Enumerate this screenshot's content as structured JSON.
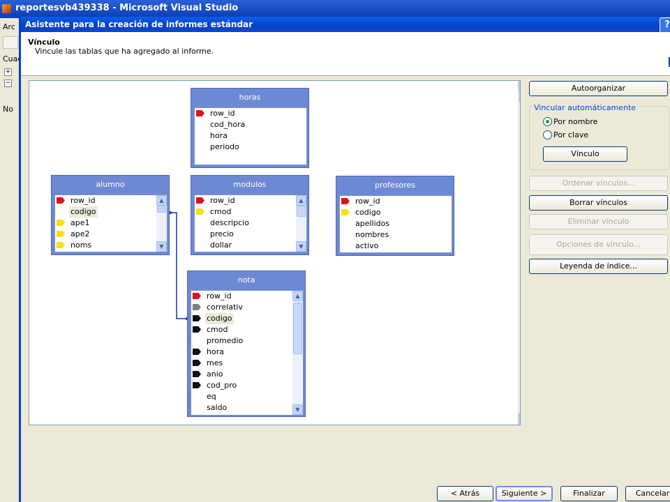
{
  "vs": {
    "title": "reportesvb439338 - Microsoft Visual Studio",
    "left_fragments": [
      "Arc",
      "Cuac",
      "No"
    ]
  },
  "dialog": {
    "title": "Asistente para la creación de informes estándar",
    "help": "?",
    "header_title": "Vínculo",
    "header_subtitle": "Vincule las tablas que ha agregado al informe."
  },
  "tables": {
    "horas": {
      "name": "horas",
      "fields": [
        {
          "name": "row_id",
          "key": "red"
        },
        {
          "name": "cod_hora",
          "key": ""
        },
        {
          "name": "hora",
          "key": ""
        },
        {
          "name": "periodo",
          "key": ""
        }
      ]
    },
    "alumno": {
      "name": "alumno",
      "fields": [
        {
          "name": "row_id",
          "key": "red"
        },
        {
          "name": "codigo",
          "key": ""
        },
        {
          "name": "ape1",
          "key": "yellow"
        },
        {
          "name": "ape2",
          "key": "yellow"
        },
        {
          "name": "noms",
          "key": "yellow"
        }
      ]
    },
    "modulos": {
      "name": "modulos",
      "fields": [
        {
          "name": "row_id",
          "key": "red"
        },
        {
          "name": "cmod",
          "key": "yellow"
        },
        {
          "name": "descripcio",
          "key": ""
        },
        {
          "name": "precio",
          "key": ""
        },
        {
          "name": "dollar",
          "key": ""
        }
      ]
    },
    "profesores": {
      "name": "profesores",
      "fields": [
        {
          "name": "row_id",
          "key": "red"
        },
        {
          "name": "codigo",
          "key": "yellow"
        },
        {
          "name": "apellidos",
          "key": ""
        },
        {
          "name": "nombres",
          "key": ""
        },
        {
          "name": "activo",
          "key": ""
        }
      ]
    },
    "nota": {
      "name": "nota",
      "fields": [
        {
          "name": "row_id",
          "key": "red"
        },
        {
          "name": "correlativ",
          "key": "gray"
        },
        {
          "name": "codigo",
          "key": "black"
        },
        {
          "name": "cmod",
          "key": "black"
        },
        {
          "name": "promedio",
          "key": ""
        },
        {
          "name": "hora",
          "key": "black"
        },
        {
          "name": "mes",
          "key": "black"
        },
        {
          "name": "anio",
          "key": "black"
        },
        {
          "name": "cod_pro",
          "key": "black"
        },
        {
          "name": "eq",
          "key": ""
        },
        {
          "name": "saldo",
          "key": ""
        }
      ]
    }
  },
  "right_panel": {
    "autoorganizar": "Autoorganizar",
    "group_label": "Vincular automáticamente",
    "por_nombre": "Por nombre",
    "por_clave": "Por clave",
    "selected": "Por nombre",
    "vinculo": "Vínculo",
    "ordenar": "Ordenar vínculos...",
    "borrar": "Borrar vínculos",
    "eliminar": "Eliminar vínculo",
    "opciones": "Opciones de vínculo...",
    "leyenda": "Leyenda de índice..."
  },
  "bottom": {
    "atras": "< Atrás",
    "siguiente": "Siguiente >",
    "finalizar": "Finalizar",
    "cancelar": "Cancelar"
  },
  "colors": {
    "key_red": "#e0101e",
    "key_yellow": "#f8e010",
    "key_black": "#101010",
    "key_gray": "#808080",
    "link_line": "#1a2fb0"
  }
}
